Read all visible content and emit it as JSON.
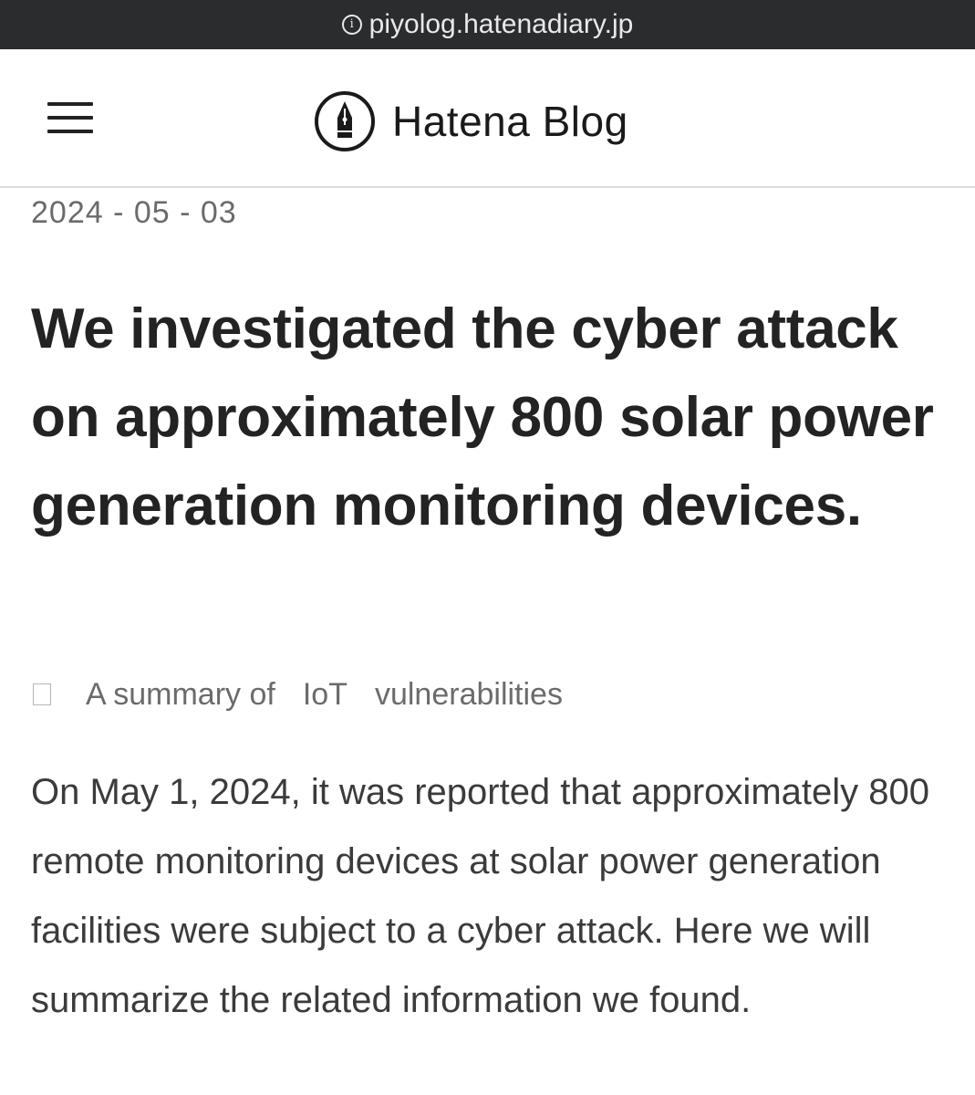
{
  "browser": {
    "url": "piyolog.hatenadiary.jp"
  },
  "header": {
    "brand": "Hatena Blog",
    "menu_icon": "hamburger-menu-icon",
    "logo_icon": "fountain-pen-nib-icon"
  },
  "article": {
    "date": "2024 - 05 - 03",
    "title": "We investigated the cyber attack on approximately 800 solar power generation monitoring devices.",
    "categories": [
      "A summary of",
      "IoT",
      "vulnerabilities"
    ],
    "body": "On May 1, 2024, it was reported that approximately 800 remote monitoring devices at solar power generation facilities were subject to a cyber attack. Here we will summarize the related information we found."
  },
  "colors": {
    "urlbar_bg": "#2b2c2e",
    "title": "#232323",
    "meta_text": "#6b6b6b",
    "body_text": "#3b3b3b"
  }
}
